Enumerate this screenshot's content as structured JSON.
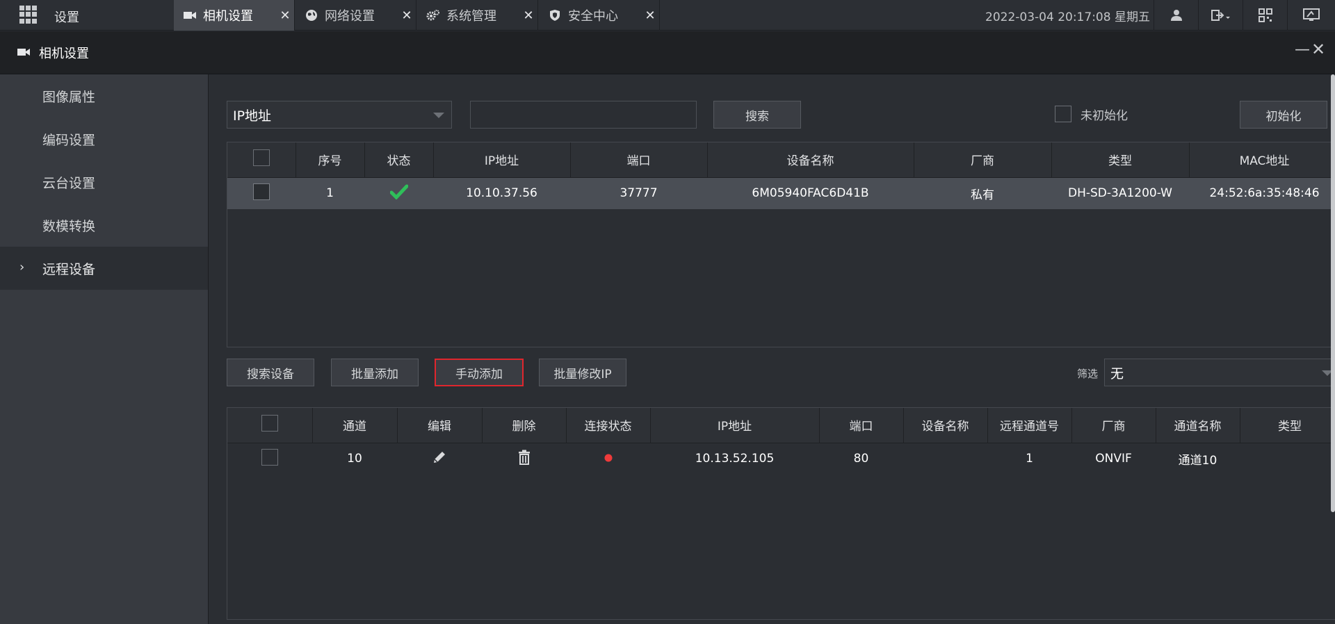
{
  "topbar": {
    "title": "设置",
    "tabs": [
      {
        "label": "相机设置",
        "close": "✕",
        "icon": "camera-icon",
        "active": true
      },
      {
        "label": "网络设置",
        "close": "✕",
        "icon": "globe-icon",
        "active": false
      },
      {
        "label": "系统管理",
        "close": "✕",
        "icon": "gears-icon",
        "active": false
      },
      {
        "label": "安全中心",
        "close": "✕",
        "icon": "shield-icon",
        "active": false
      }
    ],
    "datetime": "2022-03-04 20:17:08 星期五",
    "icons": [
      "user-icon",
      "logout-icon",
      "qr-code-icon",
      "monitor-icon"
    ]
  },
  "header": {
    "title": "相机设置",
    "minimize": "—",
    "close": "✕"
  },
  "sidebar": {
    "items": [
      {
        "label": "图像属性",
        "active": false
      },
      {
        "label": "编码设置",
        "active": false
      },
      {
        "label": "云台设置",
        "active": false
      },
      {
        "label": "数模转换",
        "active": false
      },
      {
        "label": "远程设备",
        "active": true
      }
    ],
    "active_marker": "›"
  },
  "search_bar": {
    "field_select": "IP地址",
    "search_value": "",
    "search_button": "搜索",
    "uninit_label": "未初始化",
    "init_button": "初始化"
  },
  "device_table": {
    "columns": [
      "序号",
      "状态",
      "IP地址",
      "端口",
      "设备名称",
      "厂商",
      "类型",
      "MAC地址"
    ],
    "rows": [
      {
        "index": "1",
        "status": "ok",
        "ip": "10.10.37.56",
        "port": "37777",
        "name": "6M05940FAC6D41B",
        "vendor": "私有",
        "type": "DH-SD-3A1200-W",
        "mac": "24:52:6a:35:48:46"
      }
    ]
  },
  "actions": {
    "search_devices": "搜索设备",
    "batch_add": "批量添加",
    "manual_add": "手动添加",
    "batch_modify_ip": "批量修改IP",
    "filter_label": "筛选",
    "filter_value": "无"
  },
  "added_table": {
    "columns": [
      "通道",
      "编辑",
      "删除",
      "连接状态",
      "IP地址",
      "端口",
      "设备名称",
      "远程通道号",
      "厂商",
      "通道名称",
      "类型"
    ],
    "rows": [
      {
        "channel": "10",
        "conn_status": "disconnected",
        "ip": "10.13.52.105",
        "port": "80",
        "name": "",
        "remote_channel": "1",
        "vendor": "ONVIF",
        "channel_name": "通道10",
        "type": ""
      }
    ]
  },
  "colors": {
    "status_ok": "#2fbf5a",
    "status_disconnected": "#ef3b3b",
    "highlight_border": "#e0262d"
  }
}
